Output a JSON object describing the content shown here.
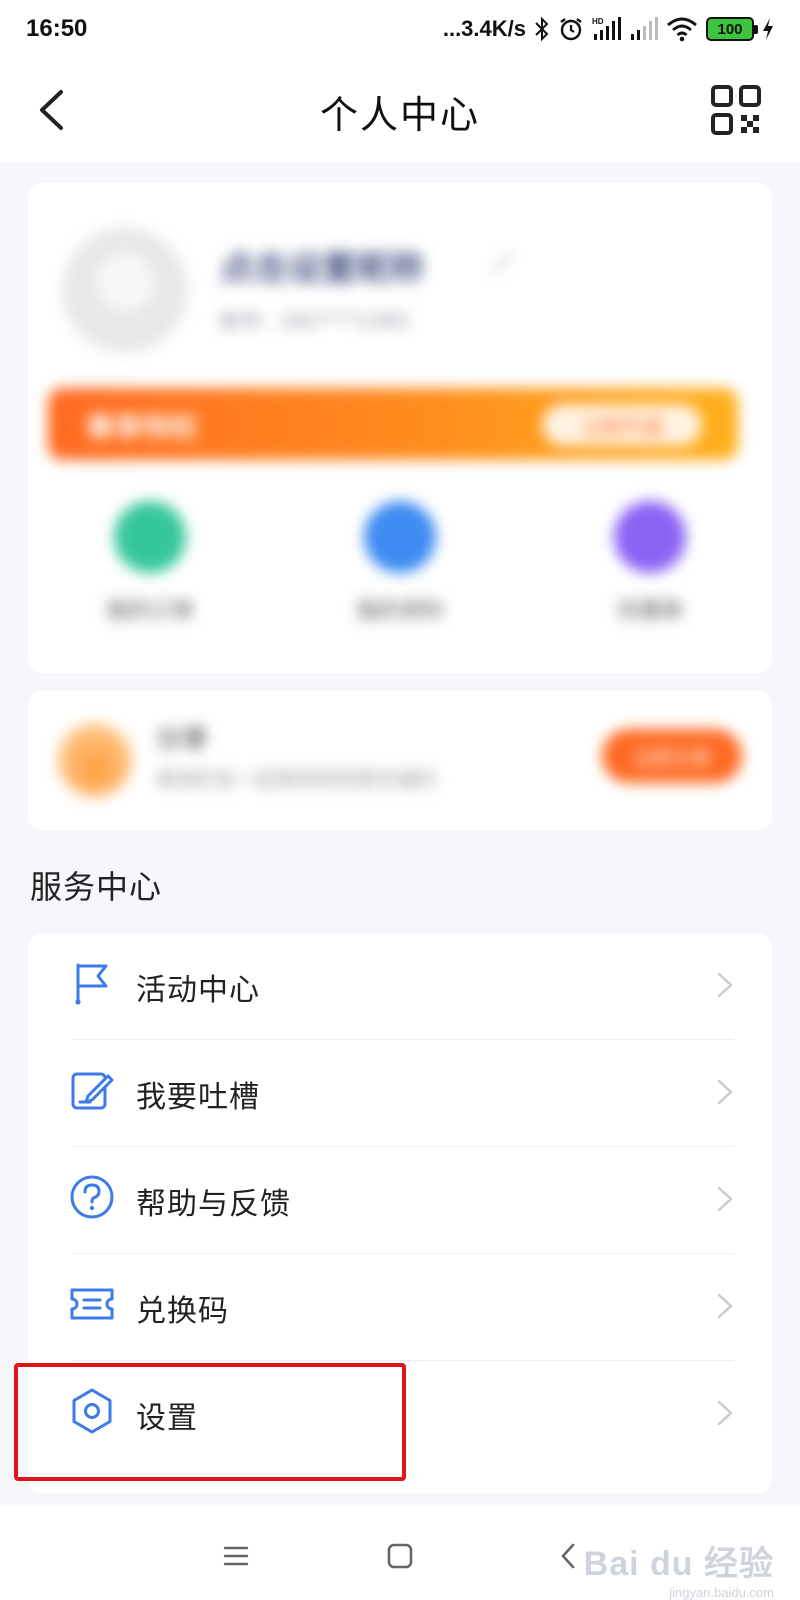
{
  "status_bar": {
    "time": "16:50",
    "network_speed": "...3.4K/s",
    "icons": [
      "bluetooth-icon",
      "alarm-icon",
      "hd-signal-icon",
      "signal-icon",
      "wifi-icon"
    ],
    "battery": "100"
  },
  "nav": {
    "title": "个人中心",
    "back_icon": "chevron-left-icon",
    "qr_icon": "qr-code-icon"
  },
  "profile": {
    "nickname": "点击设置昵称",
    "account": "账号：181****1365",
    "vip_banner_text": "尊享特权",
    "vip_button": "立即开通"
  },
  "quick_actions": [
    {
      "label": "我的订单",
      "color": "#35c79a"
    },
    {
      "label": "我的资料",
      "color": "#3d8bf2"
    },
    {
      "label": "优惠券",
      "color": "#8a63f5"
    }
  ],
  "promo": {
    "title": "分享",
    "subtitle": "邀请好友一起使用享受更多福利",
    "button": "立即分享"
  },
  "services": {
    "title": "服务中心",
    "items": [
      {
        "label": "活动中心",
        "icon": "flag-icon"
      },
      {
        "label": "我要吐槽",
        "icon": "edit-note-icon"
      },
      {
        "label": "帮助与反馈",
        "icon": "help-circle-icon"
      },
      {
        "label": "兑换码",
        "icon": "ticket-icon"
      },
      {
        "label": "设置",
        "icon": "settings-hexagon-icon"
      }
    ]
  },
  "watermark": {
    "main": "Bai du 经验",
    "sub": "jingyan.baidu.com"
  },
  "colors": {
    "accent_blue": "#3d7be8",
    "orange": "#ff6a22",
    "highlight_red": "#e0151b"
  }
}
